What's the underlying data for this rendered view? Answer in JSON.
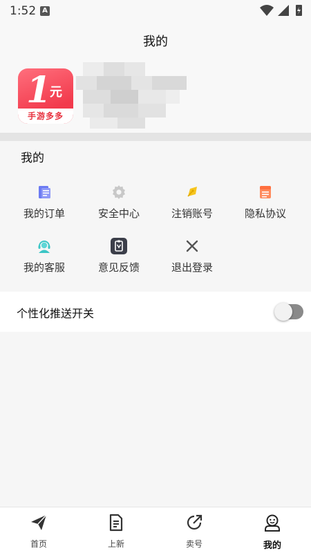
{
  "status_bar": {
    "time": "1:52",
    "notification_badge": "A"
  },
  "header": {
    "title": "我的"
  },
  "profile": {
    "logo": {
      "big_text": "1",
      "small_text": "元",
      "banner_text": "手游多多"
    }
  },
  "mine_section": {
    "title": "我的",
    "items": [
      {
        "label": "我的订单",
        "icon": "order-icon"
      },
      {
        "label": "安全中心",
        "icon": "gear-icon"
      },
      {
        "label": "注销账号",
        "icon": "pen-icon"
      },
      {
        "label": "隐私协议",
        "icon": "document-icon"
      },
      {
        "label": "我的客服",
        "icon": "customer-service-icon"
      },
      {
        "label": "意见反馈",
        "icon": "feedback-icon"
      },
      {
        "label": "退出登录",
        "icon": "close-icon"
      }
    ]
  },
  "settings": {
    "push_toggle_label": "个性化推送开关",
    "push_toggle_on": false
  },
  "tabbar": {
    "tabs": [
      {
        "label": "首页",
        "icon": "paper-plane-icon",
        "active": false
      },
      {
        "label": "上新",
        "icon": "document-icon",
        "active": false
      },
      {
        "label": "卖号",
        "icon": "external-link-icon",
        "active": false
      },
      {
        "label": "我的",
        "icon": "user-face-icon",
        "active": true
      }
    ]
  },
  "colors": {
    "accent_red": "#f23a4c",
    "toggle_off": "#8a8a8a",
    "icon_blue": "#5b6cf0",
    "icon_yellow": "#f7c51e",
    "icon_orange": "#ff7d50",
    "icon_teal": "#3cc6c6"
  }
}
